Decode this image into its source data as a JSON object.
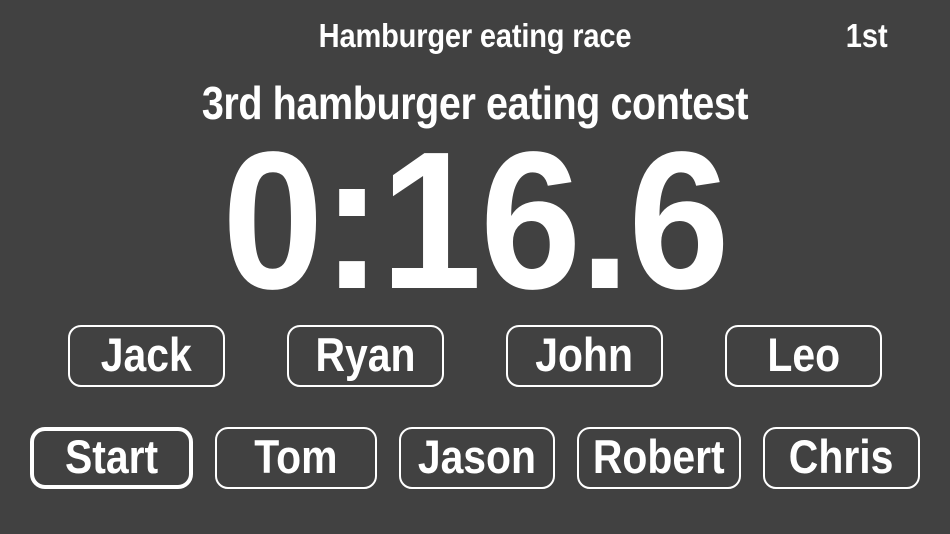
{
  "header": {
    "race_title": "Hamburger eating race",
    "rank": "1st"
  },
  "contest": {
    "title": "3rd hamburger eating contest"
  },
  "timer": {
    "display": "0:16.6"
  },
  "runners": {
    "buttons": [
      {
        "label": "Jack"
      },
      {
        "label": "Ryan"
      },
      {
        "label": "John"
      },
      {
        "label": "Leo"
      }
    ]
  },
  "controls": {
    "buttons": [
      {
        "label": "Start"
      },
      {
        "label": "Tom"
      },
      {
        "label": "Jason"
      },
      {
        "label": "Robert"
      },
      {
        "label": "Chris"
      }
    ]
  },
  "colors": {
    "background": "#414141",
    "foreground": "#ffffff",
    "border": "#ffffff"
  }
}
